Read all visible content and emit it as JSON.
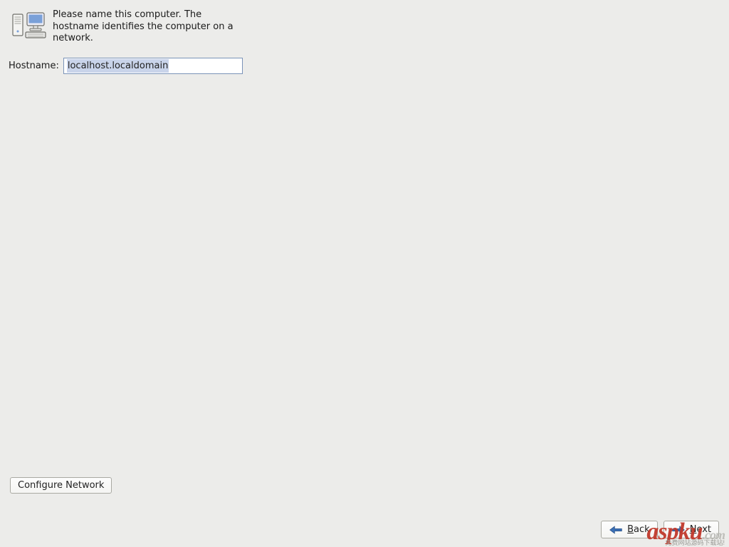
{
  "header": {
    "instruction": "Please name this computer.  The hostname identifies the computer on a network."
  },
  "form": {
    "hostname_label": "Hostname:",
    "hostname_value": "localhost.localdomain"
  },
  "buttons": {
    "configure_network": "Configure Network",
    "back": "Back",
    "next": "Next"
  },
  "watermark": {
    "main": "aspku",
    "tail": ".com",
    "sub": "免费网站源码下载站!"
  }
}
